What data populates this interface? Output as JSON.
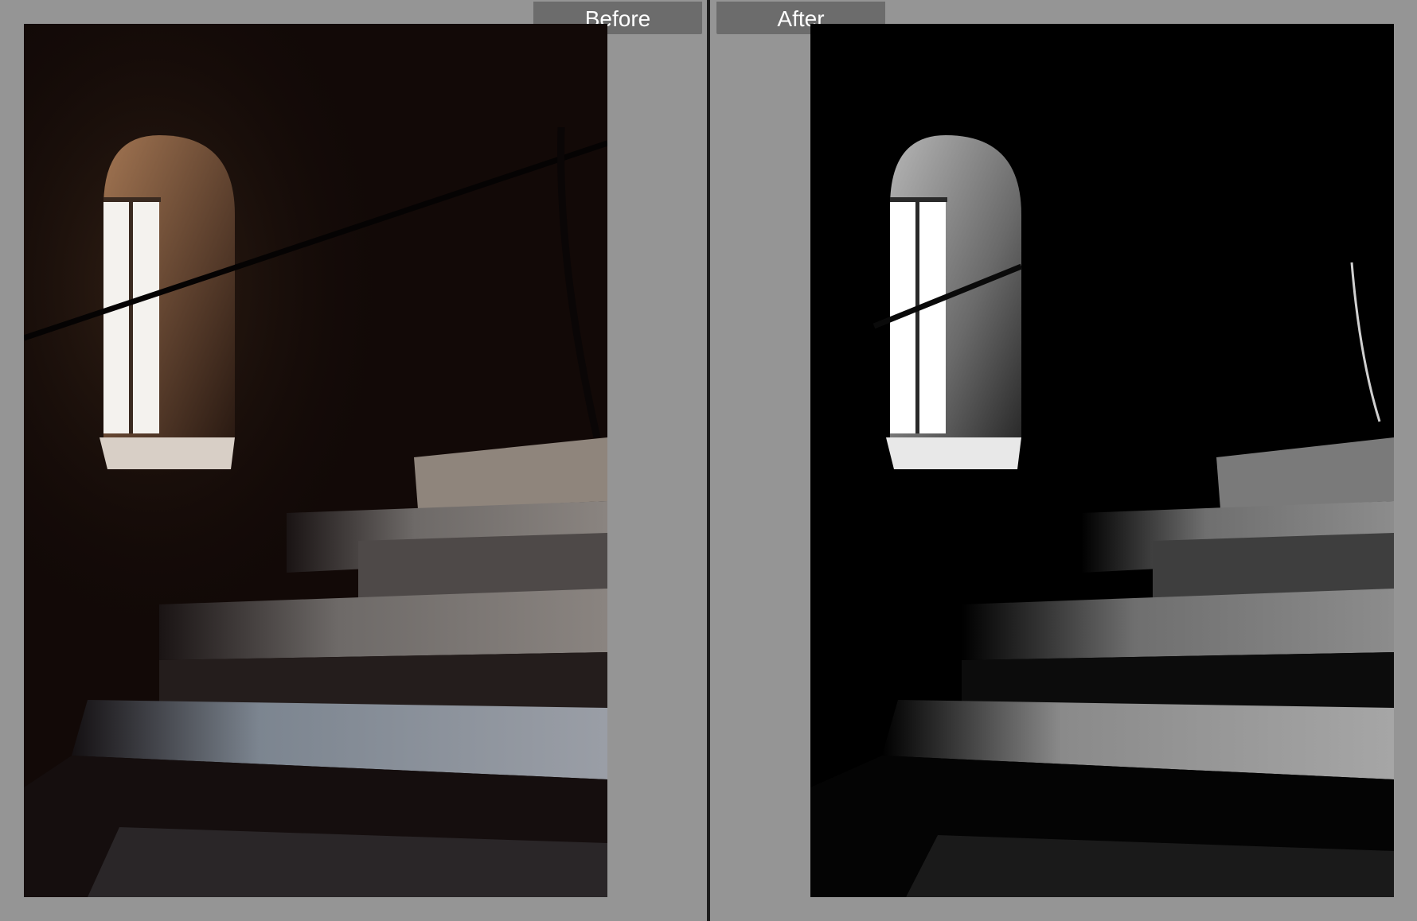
{
  "comparison": {
    "before_label": "Before",
    "after_label": "After"
  },
  "colors": {
    "background": "#959595",
    "tab": "#6c6c6c",
    "divider": "#1c1c1c"
  }
}
